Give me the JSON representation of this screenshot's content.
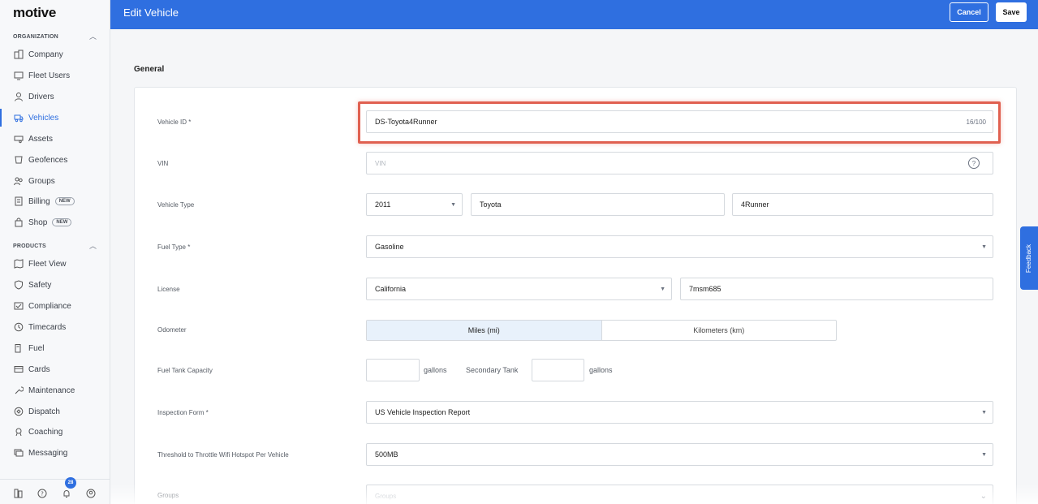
{
  "app": {
    "logo": "motive"
  },
  "header": {
    "title": "Edit Vehicle",
    "cancel_label": "Cancel",
    "save_label": "Save"
  },
  "sidebar": {
    "org_section": "ORGANIZATION",
    "org_items": [
      {
        "label": "Company",
        "icon": "building-icon"
      },
      {
        "label": "Fleet Users",
        "icon": "monitor-icon"
      },
      {
        "label": "Drivers",
        "icon": "person-icon"
      },
      {
        "label": "Vehicles",
        "icon": "truck-icon",
        "active": true
      },
      {
        "label": "Assets",
        "icon": "trailer-icon"
      },
      {
        "label": "Geofences",
        "icon": "geofence-icon"
      },
      {
        "label": "Groups",
        "icon": "group-icon"
      },
      {
        "label": "Billing",
        "icon": "billing-icon",
        "badge": "NEW"
      },
      {
        "label": "Shop",
        "icon": "bag-icon",
        "badge": "NEW"
      }
    ],
    "products_section": "PRODUCTS",
    "product_items": [
      {
        "label": "Fleet View",
        "icon": "map-icon"
      },
      {
        "label": "Safety",
        "icon": "shield-icon"
      },
      {
        "label": "Compliance",
        "icon": "compliance-icon"
      },
      {
        "label": "Timecards",
        "icon": "clock-icon"
      },
      {
        "label": "Fuel",
        "icon": "fuel-icon"
      },
      {
        "label": "Cards",
        "icon": "card-icon"
      },
      {
        "label": "Maintenance",
        "icon": "wrench-icon"
      },
      {
        "label": "Dispatch",
        "icon": "dispatch-icon"
      },
      {
        "label": "Coaching",
        "icon": "coaching-icon"
      },
      {
        "label": "Messaging",
        "icon": "message-icon"
      }
    ],
    "notification_count": "28"
  },
  "form": {
    "section_title": "General",
    "vehicle_id": {
      "label": "Vehicle ID *",
      "value": "DS-Toyota4Runner",
      "counter": "16/100"
    },
    "vin": {
      "label": "VIN",
      "placeholder": "VIN"
    },
    "vehicle_type": {
      "label": "Vehicle Type",
      "year": "2011",
      "make": "Toyota",
      "model": "4Runner"
    },
    "fuel_type": {
      "label": "Fuel Type *",
      "value": "Gasoline"
    },
    "license": {
      "label": "License",
      "state": "California",
      "plate": "7msm685"
    },
    "odometer": {
      "label": "Odometer",
      "option_miles": "Miles (mi)",
      "option_km": "Kilometers (km)",
      "selected": "Miles (mi)"
    },
    "fuel_tank": {
      "label": "Fuel Tank Capacity",
      "unit": "gallons",
      "secondary_label": "Secondary Tank",
      "secondary_unit": "gallons"
    },
    "inspection_form": {
      "label": "Inspection Form *",
      "value": "US Vehicle Inspection Report"
    },
    "throttle": {
      "label": "Threshold to Throttle Wifi Hotspot Per Vehicle",
      "value": "500MB"
    },
    "groups": {
      "label": "Groups",
      "placeholder": "Groups"
    }
  },
  "feedback_label": "Feedback",
  "colors": {
    "brand": "#2f6fe0",
    "highlight": "#e06050"
  }
}
